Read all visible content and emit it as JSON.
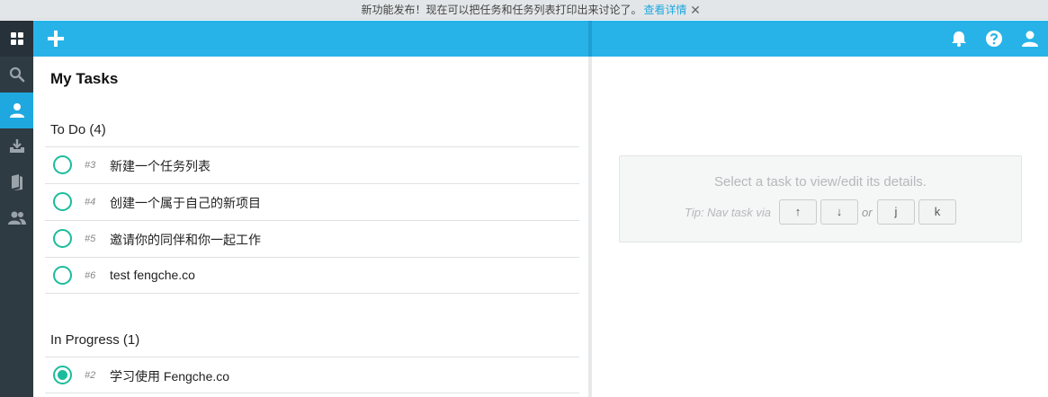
{
  "banner": {
    "text": "新功能发布！现在可以把任务和任务列表打印出来讨论了。",
    "link": "查看详情",
    "close": "✕"
  },
  "sidebar": {
    "items": [
      {
        "icon": "apps-grid-icon"
      },
      {
        "icon": "search-icon"
      },
      {
        "icon": "person-icon",
        "active": true
      },
      {
        "icon": "inbox-download-icon"
      },
      {
        "icon": "books-icon"
      },
      {
        "icon": "team-icon"
      }
    ]
  },
  "topbar": {
    "add_icon": "plus-icon",
    "right_icons": [
      "bell-icon",
      "help-icon",
      "user-icon"
    ]
  },
  "main": {
    "title": "My Tasks",
    "groups": [
      {
        "title": "To Do (4)",
        "tasks": [
          {
            "num": "#3",
            "title": "新建一个任务列表"
          },
          {
            "num": "#4",
            "title": "创建一个属于自己的新项目"
          },
          {
            "num": "#5",
            "title": "邀请你的同伴和你一起工作"
          },
          {
            "num": "#6",
            "title": "test fengche.co"
          }
        ]
      },
      {
        "title": "In Progress (1)",
        "tasks": [
          {
            "num": "#2",
            "title": "学习使用 Fengche.co"
          }
        ]
      }
    ]
  },
  "detail": {
    "message": "Select a task to view/edit its details.",
    "tip": "Tip: Nav task via",
    "or": "or",
    "keys": [
      "↑",
      "↓",
      "j",
      "k"
    ]
  },
  "colors": {
    "accent": "#28b3e8",
    "sidebar": "#2f3b43",
    "check": "#1abc9c"
  }
}
